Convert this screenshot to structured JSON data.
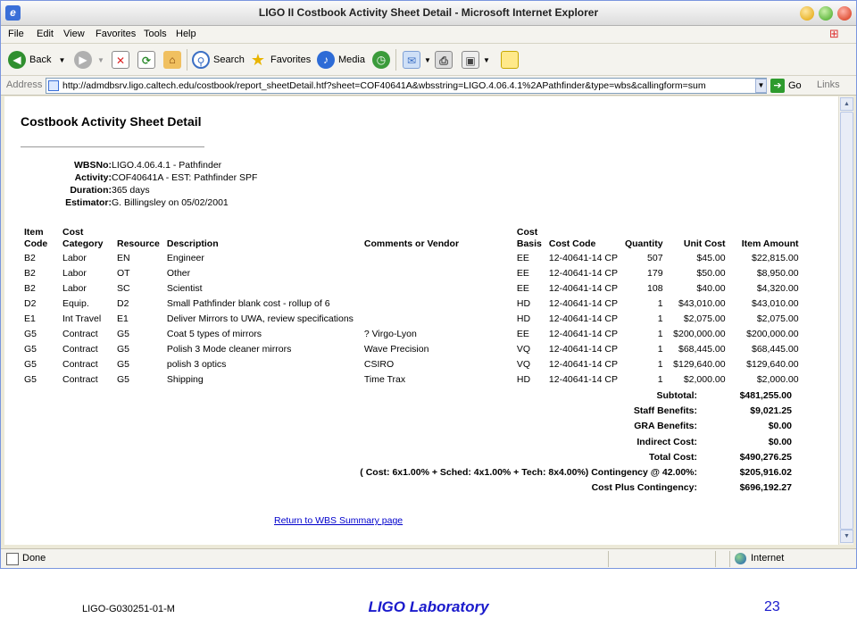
{
  "window": {
    "title": "LIGO II Costbook Activity Sheet Detail - Microsoft Internet Explorer"
  },
  "menu": [
    "File",
    "Edit",
    "View",
    "Favorites",
    "Tools",
    "Help"
  ],
  "toolbar": {
    "back": "Back",
    "search": "Search",
    "favorites": "Favorites",
    "media": "Media"
  },
  "address": {
    "label": "Address",
    "url": "http://admdbsrv.ligo.caltech.edu/costbook/report_sheetDetail.htf?sheet=COF40641A&wbsstring=LIGO.4.06.4.1%2APathfinder&type=wbs&callingform=sum",
    "go": "Go",
    "links": "Links"
  },
  "page": {
    "title": "Costbook Activity Sheet Detail",
    "meta": [
      {
        "label": "WBSNo:",
        "value": "LIGO.4.06.4.1 - Pathfinder"
      },
      {
        "label": "Activity:",
        "value": "COF40641A - EST: Pathfinder SPF"
      },
      {
        "label": "Duration:",
        "value": "365 days"
      },
      {
        "label": "Estimator:",
        "value": "G. Billingsley on 05/02/2001"
      }
    ],
    "columns": {
      "item_code_1": "Item",
      "item_code_2": "Code",
      "cost_category_1": "Cost",
      "cost_category_2": "Category",
      "resource": "Resource",
      "description": "Description",
      "comments": "Comments or Vendor",
      "cost_basis_1": "Cost",
      "cost_basis_2": "Basis",
      "cost_code": "Cost Code",
      "quantity": "Quantity",
      "unit_cost": "Unit Cost",
      "item_amount": "Item Amount"
    },
    "rows": [
      {
        "code": "B2",
        "category": "Labor",
        "resource": "EN",
        "description": "Engineer",
        "comments": "",
        "basis": "EE",
        "cost_code": "12-40641-14 CP",
        "quantity": "507",
        "unit_cost": "$45.00",
        "amount": "$22,815.00"
      },
      {
        "code": "B2",
        "category": "Labor",
        "resource": "OT",
        "description": "Other",
        "comments": "",
        "basis": "EE",
        "cost_code": "12-40641-14 CP",
        "quantity": "179",
        "unit_cost": "$50.00",
        "amount": "$8,950.00"
      },
      {
        "code": "B2",
        "category": "Labor",
        "resource": "SC",
        "description": "Scientist",
        "comments": "",
        "basis": "EE",
        "cost_code": "12-40641-14 CP",
        "quantity": "108",
        "unit_cost": "$40.00",
        "amount": "$4,320.00"
      },
      {
        "code": "D2",
        "category": "Equip.",
        "resource": "D2",
        "description": "Small Pathfinder blank cost - rollup of 6",
        "comments": "",
        "basis": "HD",
        "cost_code": "12-40641-14 CP",
        "quantity": "1",
        "unit_cost": "$43,010.00",
        "amount": "$43,010.00"
      },
      {
        "code": "E1",
        "category": "Int Travel",
        "resource": "E1",
        "description": "Deliver Mirrors to UWA, review specifications",
        "comments": "",
        "basis": "HD",
        "cost_code": "12-40641-14 CP",
        "quantity": "1",
        "unit_cost": "$2,075.00",
        "amount": "$2,075.00"
      },
      {
        "code": "G5",
        "category": "Contract",
        "resource": "G5",
        "description": "Coat 5 types of mirrors",
        "comments": "? Virgo-Lyon",
        "basis": "EE",
        "cost_code": "12-40641-14 CP",
        "quantity": "1",
        "unit_cost": "$200,000.00",
        "amount": "$200,000.00"
      },
      {
        "code": "G5",
        "category": "Contract",
        "resource": "G5",
        "description": "Polish 3 Mode cleaner mirrors",
        "comments": "Wave Precision",
        "basis": "VQ",
        "cost_code": "12-40641-14 CP",
        "quantity": "1",
        "unit_cost": "$68,445.00",
        "amount": "$68,445.00"
      },
      {
        "code": "G5",
        "category": "Contract",
        "resource": "G5",
        "description": "polish 3 optics",
        "comments": "CSIRO",
        "basis": "VQ",
        "cost_code": "12-40641-14 CP",
        "quantity": "1",
        "unit_cost": "$129,640.00",
        "amount": "$129,640.00"
      },
      {
        "code": "G5",
        "category": "Contract",
        "resource": "G5",
        "description": "Shipping",
        "comments": "Time Trax",
        "basis": "HD",
        "cost_code": "12-40641-14 CP",
        "quantity": "1",
        "unit_cost": "$2,000.00",
        "amount": "$2,000.00"
      }
    ],
    "totals": [
      {
        "label": "Subtotal:",
        "value": "$481,255.00"
      },
      {
        "label": "Staff Benefits:",
        "value": "$9,021.25"
      },
      {
        "label": "GRA Benefits:",
        "value": "$0.00"
      },
      {
        "label": "Indirect Cost:",
        "value": "$0.00"
      },
      {
        "label": "Total Cost:",
        "value": "$490,276.25"
      },
      {
        "label": "( Cost: 6x1.00% + Sched: 4x1.00% + Tech: 8x4.00%) Contingency @ 42.00%:",
        "value": "$205,916.02"
      },
      {
        "label": "Cost Plus Contingency:",
        "value": "$696,192.27"
      }
    ],
    "return_link": "Return to WBS Summary page"
  },
  "status": {
    "left": "Done",
    "zone": "Internet"
  },
  "slide_footer": {
    "doc_id": "LIGO-G030251-01-M",
    "lab": "LIGO Laboratory",
    "page_number": "23"
  }
}
